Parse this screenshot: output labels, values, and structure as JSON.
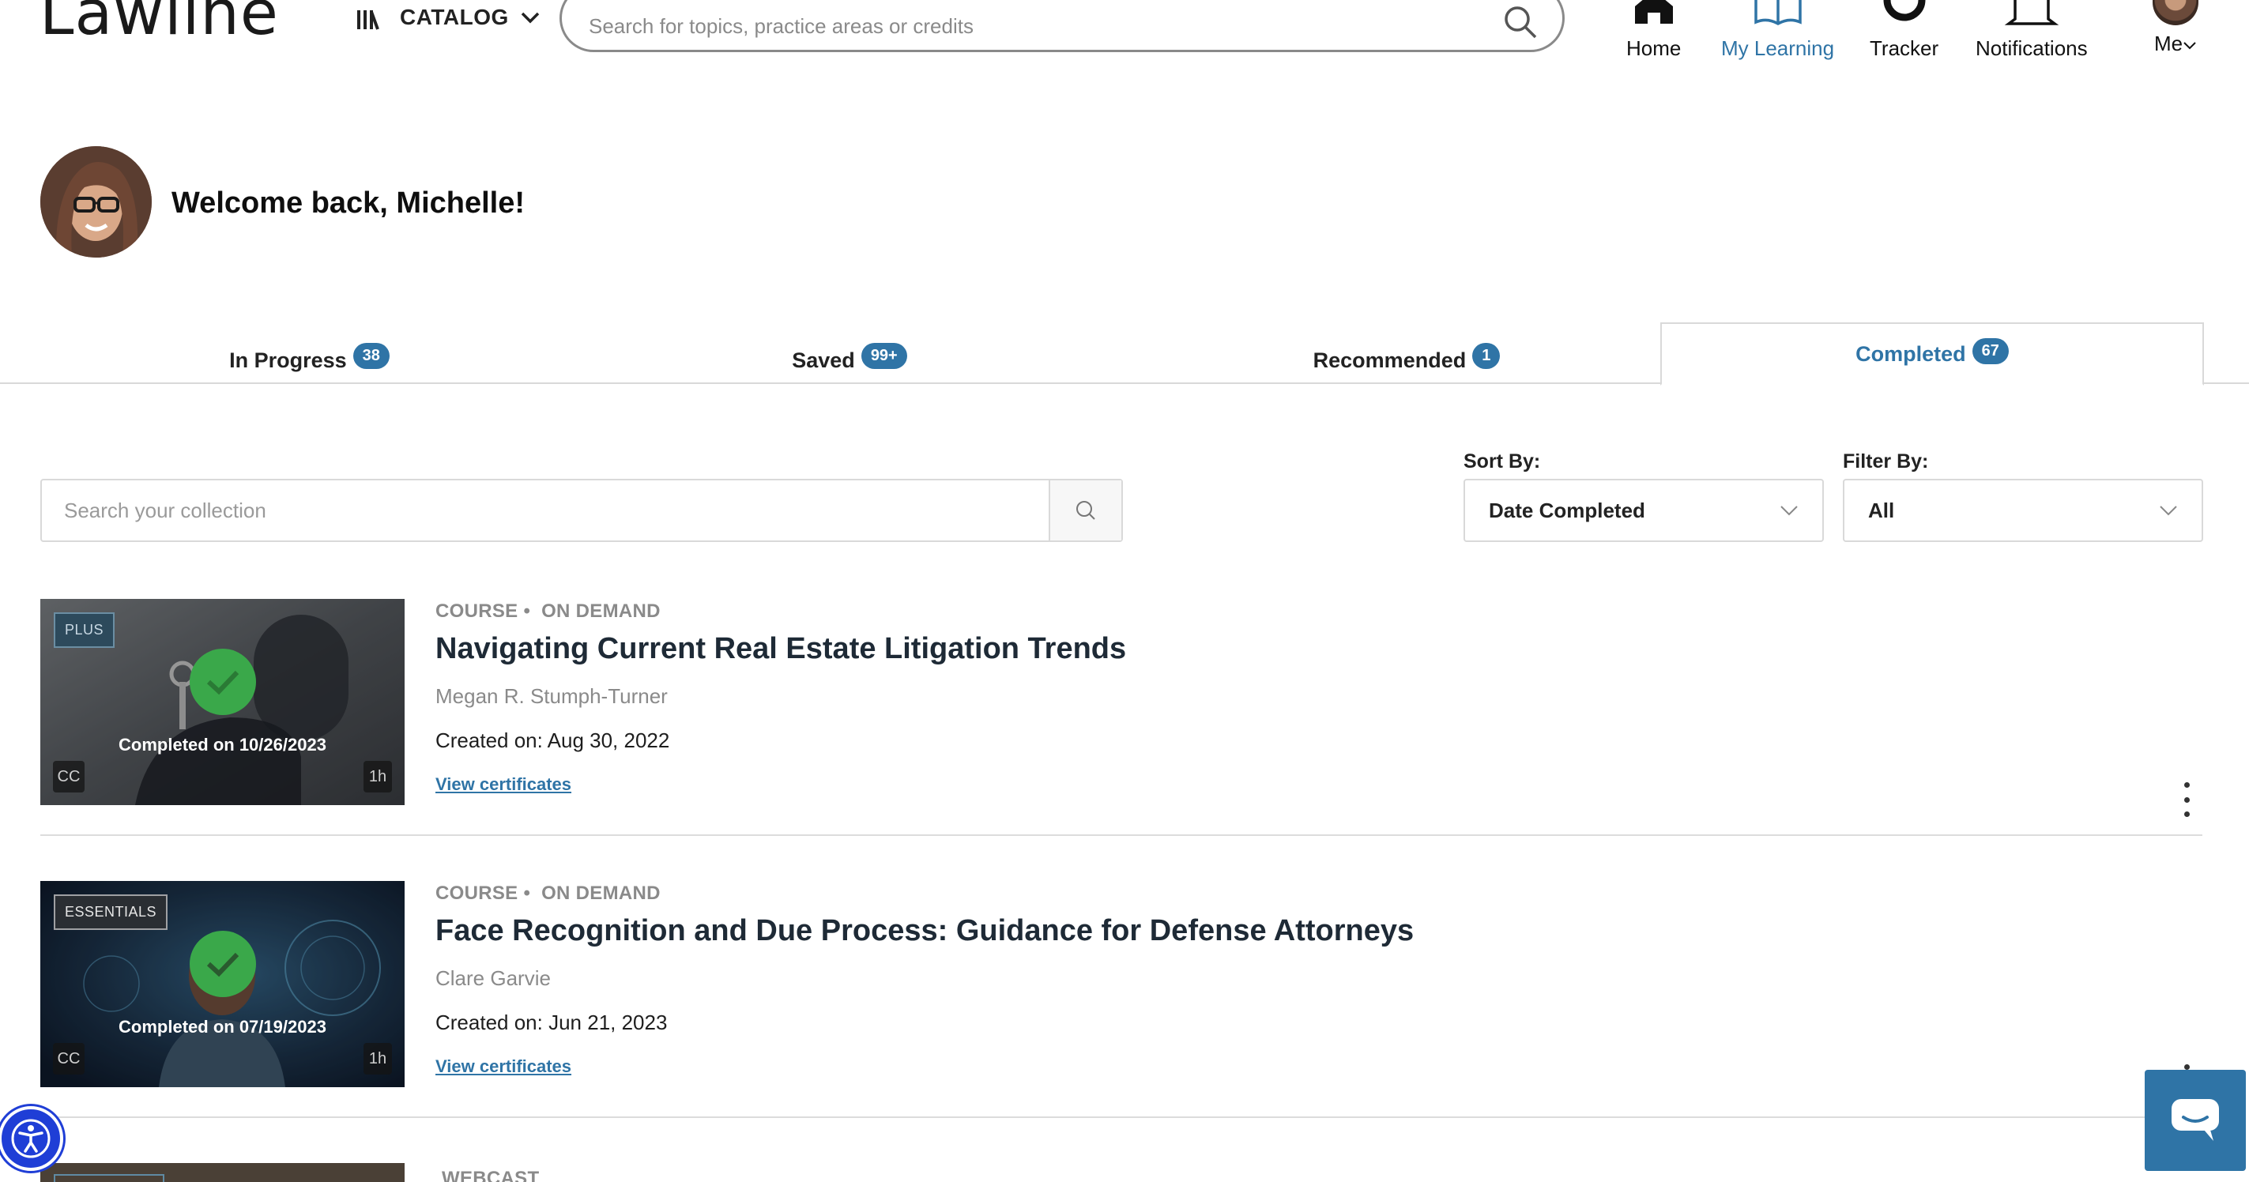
{
  "header": {
    "logo": "Lawline",
    "catalog_label": "CATALOG",
    "search_placeholder": "Search for topics, practice areas or credits",
    "nav": {
      "home": "Home",
      "my_learning": "My Learning",
      "tracker": "Tracker",
      "notifications": "Notifications",
      "me": "Me"
    }
  },
  "welcome": "Welcome back, Michelle!",
  "tabs": [
    {
      "label": "In Progress",
      "count": "38"
    },
    {
      "label": "Saved",
      "count": "99+"
    },
    {
      "label": "Recommended",
      "count": "1"
    },
    {
      "label": "Completed",
      "count": "67"
    }
  ],
  "filters": {
    "search_placeholder": "Search your collection",
    "sort_label": "Sort By:",
    "sort_value": "Date Completed",
    "filter_label": "Filter By:",
    "filter_value": "All"
  },
  "courses": [
    {
      "tag": "PLUS",
      "completed_on": "Completed on 10/26/2023",
      "cc": "CC",
      "duration": "1h",
      "type": "COURSE",
      "format": "ON DEMAND",
      "title": "Navigating Current Real Estate Litigation Trends",
      "author": "Megan R. Stumph-Turner",
      "created": "Created on: Aug 30, 2022",
      "cert_link": "View certificates"
    },
    {
      "tag": "ESSENTIALS",
      "completed_on": "Completed on 07/19/2023",
      "cc": "CC",
      "duration": "1h",
      "type": "COURSE",
      "format": "ON DEMAND",
      "title": "Face Recognition and Due Process: Guidance for Defense Attorneys",
      "author": "Clare Garvie",
      "created": "Created on: Jun 21, 2023",
      "cert_link": "View certificates"
    },
    {
      "type": "WEBCAST"
    }
  ],
  "colors": {
    "accent": "#2f74a6",
    "check": "#3aa84a",
    "a11y": "#1f3ed6"
  },
  "icons": [
    "books-icon",
    "chevron-down-icon",
    "search-icon",
    "home-icon",
    "book-icon",
    "tracker-icon",
    "bell-icon",
    "accessibility-icon",
    "chat-icon",
    "kebab-menu-icon",
    "checkmark-icon"
  ]
}
